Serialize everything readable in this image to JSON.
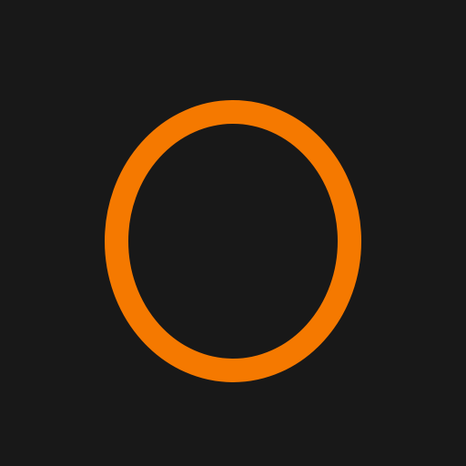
{
  "background_color": "#181818",
  "ring": {
    "icon": "ring-icon",
    "stroke_color": "#F57900",
    "fill_color": "none"
  }
}
